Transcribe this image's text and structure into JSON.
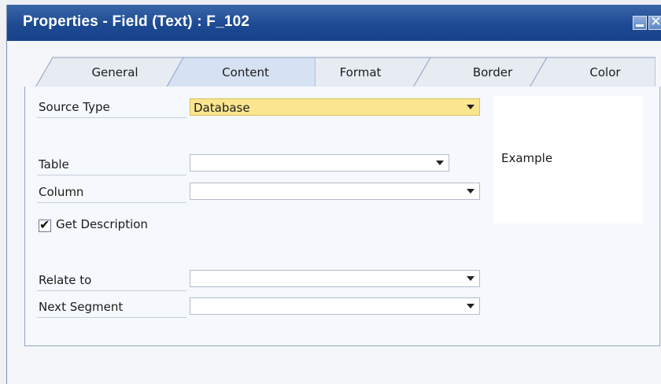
{
  "window": {
    "title": "Properties - Field (Text) : F_102",
    "minimize_glyph": "",
    "close_glyph": "✕"
  },
  "tabs": [
    {
      "label": "General",
      "selected": false
    },
    {
      "label": "Content",
      "selected": true
    },
    {
      "label": "Format",
      "selected": false
    },
    {
      "label": "Border",
      "selected": false
    },
    {
      "label": "Color",
      "selected": false
    }
  ],
  "form": {
    "source_type": {
      "label": "Source Type",
      "value": "Database"
    },
    "table": {
      "label": "Table",
      "value": ""
    },
    "column": {
      "label": "Column",
      "value": ""
    },
    "get_description": {
      "label": "Get Description",
      "checked": true
    },
    "relate_to": {
      "label": "Relate to",
      "value": ""
    },
    "next_segment": {
      "label": "Next Segment",
      "value": ""
    }
  },
  "example": {
    "text": "Example"
  },
  "colors": {
    "titlebar": "#1d4a93",
    "active_field": "#fbe68f",
    "selected_tab": "#d6e2f3"
  }
}
